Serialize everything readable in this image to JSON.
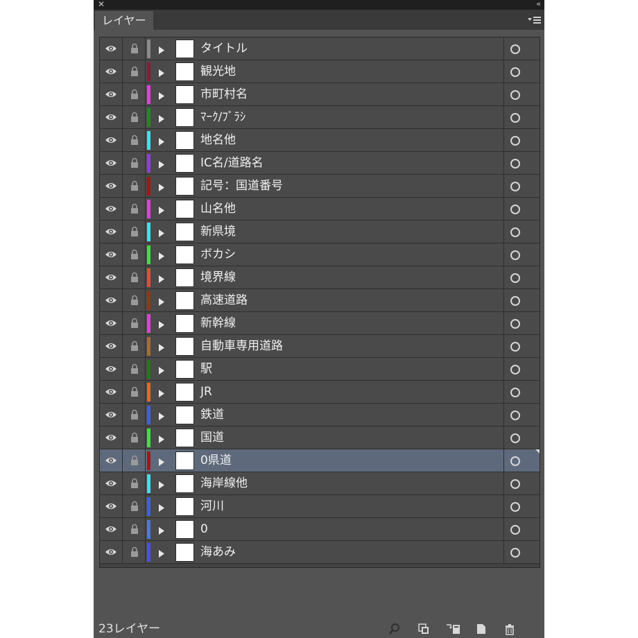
{
  "panel": {
    "close_glyph": "✕",
    "collapse_glyph": "«",
    "tab_label": "レイヤー",
    "menu_icon": "panel-menu-icon"
  },
  "layers": [
    {
      "name": "タイトル",
      "color": "#8a8a8a"
    },
    {
      "name": "観光地",
      "color": "#8b1a3a"
    },
    {
      "name": "市町村名",
      "color": "#e040e0"
    },
    {
      "name": "ﾏｰｸ/ﾌﾞﾗｼ",
      "color": "#1f8a1f"
    },
    {
      "name": "地名他",
      "color": "#40e0e8"
    },
    {
      "name": "IC名/道路名",
      "color": "#8a40e0"
    },
    {
      "name": "記号：国道番号",
      "color": "#a01818"
    },
    {
      "name": "山名他",
      "color": "#e040e0"
    },
    {
      "name": "新県境",
      "color": "#40e0e8"
    },
    {
      "name": "ボカシ",
      "color": "#40e040"
    },
    {
      "name": "境界線",
      "color": "#e05030"
    },
    {
      "name": "高速道路",
      "color": "#8a3a1a"
    },
    {
      "name": "新幹線",
      "color": "#e040e0"
    },
    {
      "name": "自動車専用道路",
      "color": "#a07030"
    },
    {
      "name": "駅",
      "color": "#1f7a1f"
    },
    {
      "name": "JR",
      "color": "#e06a20"
    },
    {
      "name": "鉄道",
      "color": "#4060e0"
    },
    {
      "name": "国道",
      "color": "#40e040"
    },
    {
      "name": "0県道",
      "color": "#a01818",
      "selected": true
    },
    {
      "name": "海岸線他",
      "color": "#40e0e8"
    },
    {
      "name": "河川",
      "color": "#4060e0"
    },
    {
      "name": "0",
      "color": "#4a7ae0"
    },
    {
      "name": "海あみ",
      "color": "#4a50e0"
    }
  ],
  "footer": {
    "count_label": "23レイヤー",
    "icons": [
      "locate-object-icon",
      "make-clipping-mask-icon",
      "create-sublayer-icon",
      "create-new-layer-icon",
      "delete-layer-icon"
    ]
  },
  "colors": {
    "panel_bg": "#535353",
    "row_bg": "#4a4a4a",
    "selected_row_bg": "#5e6a7c"
  }
}
